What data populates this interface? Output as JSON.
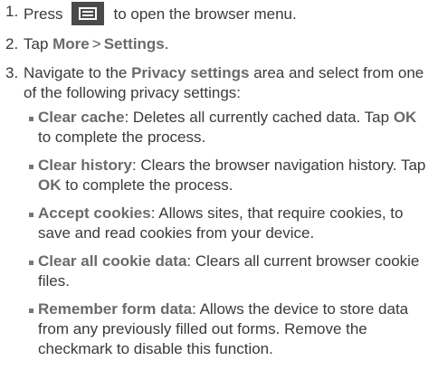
{
  "steps": [
    {
      "number": "1.",
      "pre": "Press",
      "icon": "menu-icon",
      "post": "to open the browser menu."
    },
    {
      "number": "2.",
      "pre": "Tap ",
      "more": "More",
      "sep": ">",
      "settings": "Settings",
      "post": "."
    },
    {
      "number": "3.",
      "pre": "Navigate to the ",
      "area": "Privacy settings",
      "post": " area and select from one of the following privacy settings:"
    }
  ],
  "settings": [
    {
      "name": "Clear cache",
      "desc": ": Deletes all currently cached data. Tap ",
      "ok": "OK",
      "after": " to complete the process."
    },
    {
      "name": "Clear history",
      "desc": ": Clears the browser navigation history. Tap ",
      "ok": "OK",
      "after": " to complete the process."
    },
    {
      "name": "Accept cookies",
      "desc": ": Allows sites, that require cookies, to save and read cookies from your device."
    },
    {
      "name": "Clear all cookie data",
      "desc": ": Clears all current browser cookie files."
    },
    {
      "name": "Remember form data",
      "desc": ": Allows the device to store data from any previously filled out forms. Remove the checkmark to disable this function."
    }
  ]
}
